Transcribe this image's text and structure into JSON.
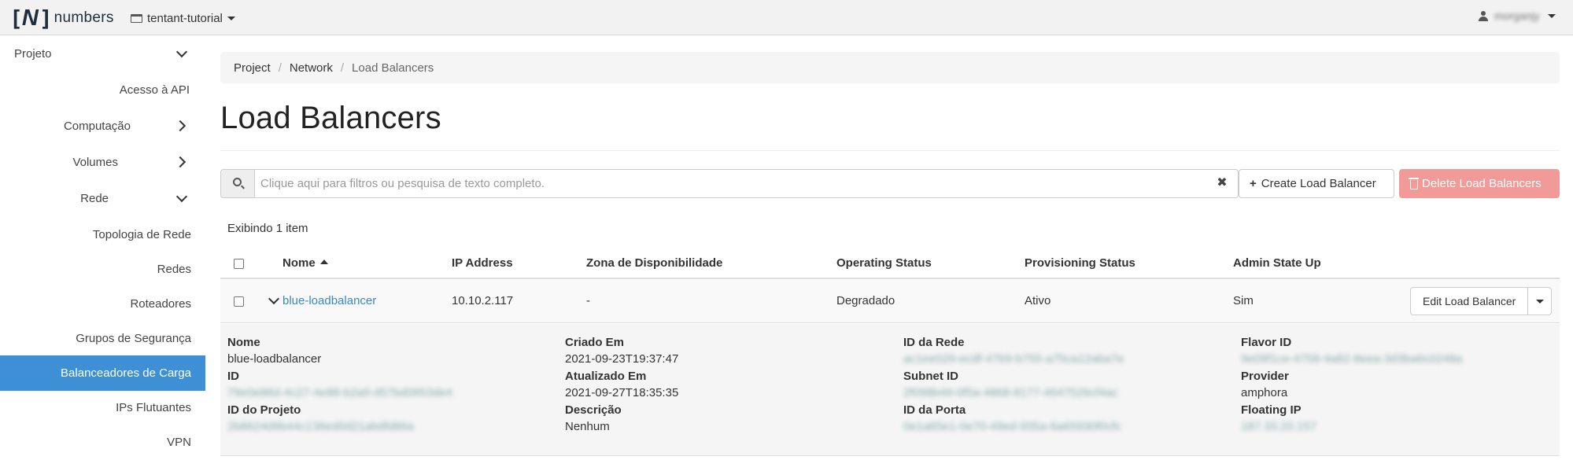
{
  "topbar": {
    "logo_left": "[",
    "logo_n": "N",
    "logo_right": "]",
    "logo_text": "numbers",
    "tenant": "tentant-tutorial",
    "user": "morganjy"
  },
  "sidebar": {
    "items": [
      {
        "label": "Projeto"
      },
      {
        "label": "Acesso à API"
      },
      {
        "label": "Computação"
      },
      {
        "label": "Volumes"
      },
      {
        "label": "Rede"
      },
      {
        "label": "Topologia de Rede"
      },
      {
        "label": "Redes"
      },
      {
        "label": "Roteadores"
      },
      {
        "label": "Grupos de Segurança"
      },
      {
        "label": "Balanceadores de Carga"
      },
      {
        "label": "IPs Flutuantes"
      },
      {
        "label": "VPN"
      }
    ]
  },
  "breadcrumb": {
    "items": [
      "Project",
      "Network",
      "Load Balancers"
    ],
    "separator": "/"
  },
  "page": {
    "title": "Load Balancers"
  },
  "filter": {
    "placeholder": "Clique aqui para filtros ou pesquisa de texto completo.",
    "clear": "✖"
  },
  "actions": {
    "create_icon": "+",
    "create_label": "Create Load Balancer",
    "delete_label": "Delete Load Balancers"
  },
  "table": {
    "count_text": "Exibindo 1 item",
    "columns": [
      "Nome",
      "IP Address",
      "Zona de Disponibilidade",
      "Operating Status",
      "Provisioning Status",
      "Admin State Up"
    ],
    "rows": [
      {
        "name": "blue-loadbalancer",
        "ip": "10.10.2.117",
        "zone": "-",
        "operating_status": "Degradado",
        "provisioning_status": "Ativo",
        "admin_state_up": "Sim",
        "edit_label": "Edit Load Balancer"
      }
    ]
  },
  "details": {
    "nome_label": "Nome",
    "nome_value": "blue-loadbalancer",
    "id_label": "ID",
    "id_value": "79e0e86d-4c27-4e88-b2a9-d57bd0953de4",
    "projeto_label": "ID do Projeto",
    "projeto_value": "2b8624d9b44c136ed0d21abdfd86a",
    "criado_label": "Criado Em",
    "criado_value": "2021-09-23T19:37:47",
    "atualizado_label": "Atualizado Em",
    "atualizado_value": "2021-09-27T18:35:35",
    "descricao_label": "Descrição",
    "descricao_value": "Nenhum",
    "rede_label": "ID da Rede",
    "rede_value": "ac1ee029-ecdf-47b9-b755-a75ca12aba7e",
    "subnet_label": "Subnet ID",
    "subnet_value": "2f098b49-0f5a-4868-8177-4647526cf4ac",
    "porta_label": "ID da Porta",
    "porta_value": "0e1a65e1-0e70-49ed-935a-6a65930f0cfc",
    "flavor_label": "Flavor ID",
    "flavor_value": "9e09f1ce-4758-4a82-8eea-3d3ba6c0248a",
    "provider_label": "Provider",
    "provider_value": "amphora",
    "floating_label": "Floating IP",
    "floating_value": "187.33.20.157"
  }
}
